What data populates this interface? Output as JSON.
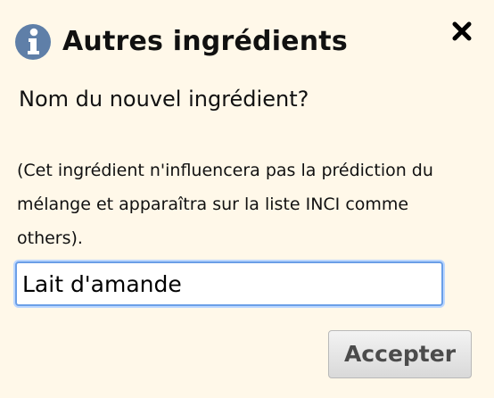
{
  "dialog": {
    "title": "Autres ingrédients",
    "title_icon": "info-icon",
    "close_icon": "close-icon",
    "question": "Nom du nouvel ingrédient?",
    "note": "(Cet ingrédient n'influencera pas la prédiction du mélange et apparaîtra sur la liste INCI comme others).",
    "ingredient_value": "Lait d'amande",
    "accept_label": "Accepter"
  },
  "colors": {
    "background": "#fff8e9",
    "info_icon_blue": "#5f7fa8",
    "input_focus_border": "#6b9fe7",
    "button_text": "#4b4b4b"
  }
}
